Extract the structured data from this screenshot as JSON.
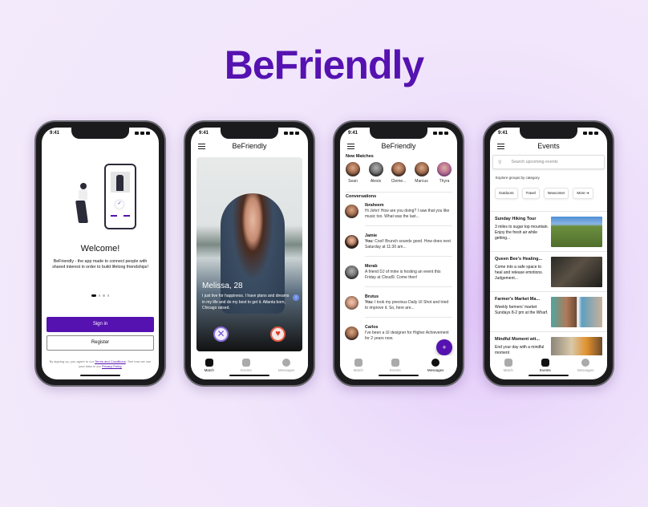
{
  "brand": "BeFriendly",
  "status": {
    "time": "9:41"
  },
  "welcome": {
    "title": "Welcome!",
    "body": "BeFriendly - the app made to connect people with shared interest in order to build lifelong friendships!",
    "page_dots": {
      "current": 1,
      "total": 4
    },
    "sign_in": "Sign in",
    "register": "Register",
    "legal_prefix": "By signing up, you agree to our",
    "terms": "Terms and Conditions",
    "legal_mid": ". See how we use your data in our",
    "privacy": "Privacy Policy"
  },
  "match": {
    "header": "BeFriendly",
    "name": "Melissa, 28",
    "bio": "I just live for happiness. I have plans and dreams in my life and do my best to get it. Atlanta born, Chicago raised."
  },
  "tabs": [
    "Match",
    "Events",
    "Messages"
  ],
  "messages": {
    "header": "BeFriendly",
    "new_matches_label": "New Matches",
    "new_matches": [
      "Sean",
      "Alexis",
      "Cleme...",
      "Marcus",
      "Thyra"
    ],
    "conversations_label": "Conversations",
    "conversations": [
      {
        "name": "Ibraheem",
        "prefix": "",
        "text": "Hi John! How are you doing? I saw that you like music too. What was the last..."
      },
      {
        "name": "Jamie",
        "prefix": "You:",
        "text": "Cool! Brunch sounds good. How does next Saturday at 11:30 am..."
      },
      {
        "name": "Merab",
        "prefix": "",
        "text": "A friend DJ of mine is hosting an event this Friday at Cloud9. Come then!"
      },
      {
        "name": "Brutus",
        "prefix": "You:",
        "text": "I took my previous Daily UI Shot and tried to improve it. So, here are..."
      },
      {
        "name": "Carlos",
        "prefix": "",
        "text": "I've been a UI designer for Higher Achievement for 2 years now."
      }
    ],
    "fab": "+"
  },
  "events": {
    "header": "Events",
    "search_placeholder": "Search upcoming events",
    "explore_label": "Explore groups by category",
    "categories": [
      "Outdoors",
      "Travel",
      "Newcomer",
      "More"
    ],
    "items": [
      {
        "title": "Sunday Hiking Tour",
        "desc": "3 miles to sugar top mountain. Enjoy the fresh air while getting..."
      },
      {
        "title": "Queen Bee's Healing...",
        "desc": "Come into a safe space to heal and release emotions. Judgement..."
      },
      {
        "title": "Farmer's Market Ma...",
        "desc": "Weekly farmers' market Sundays 8-2 pm at the Wharf."
      },
      {
        "title": "Mindful Moment wit...",
        "desc": "End your day with a mindful moment"
      }
    ]
  },
  "colors": {
    "accent": "#5512b0",
    "background": "#f1e6fb"
  }
}
